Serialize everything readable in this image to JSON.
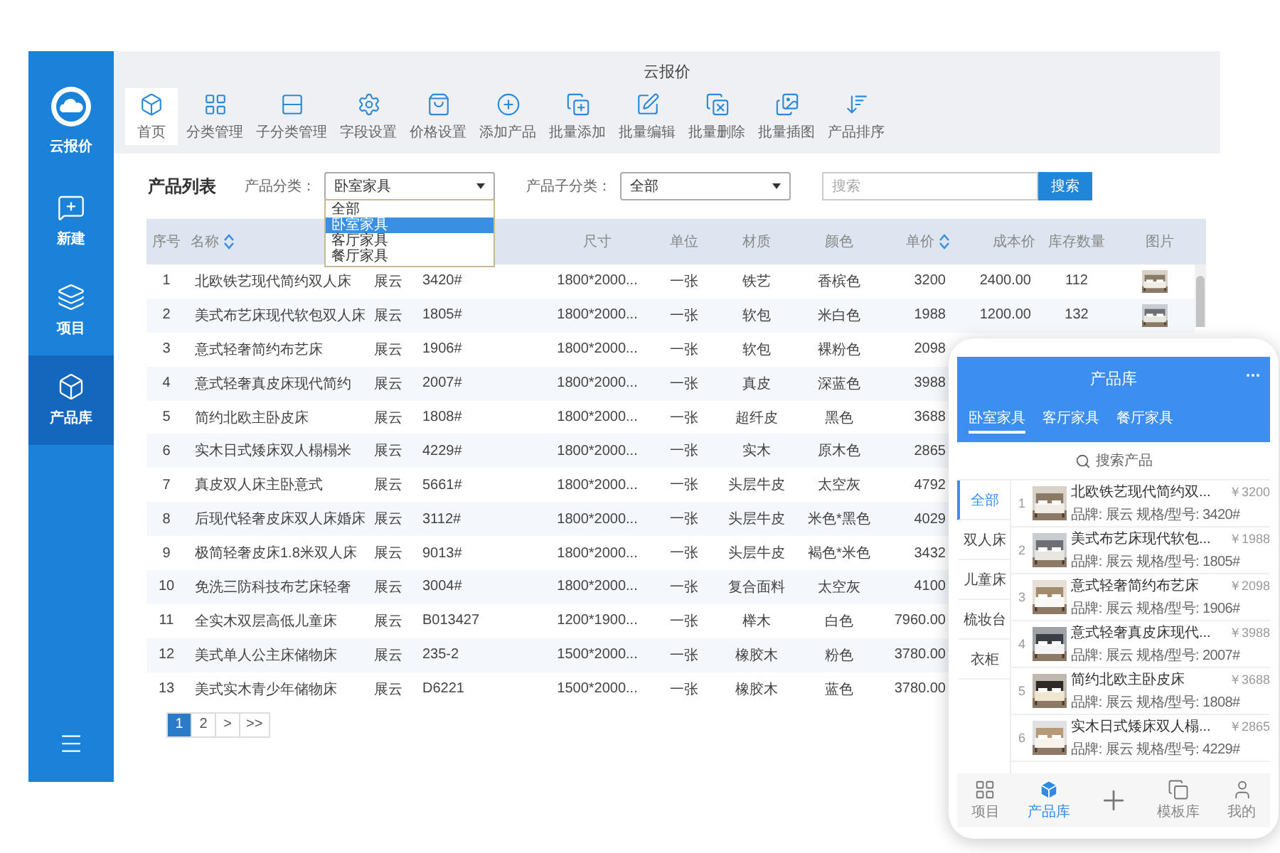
{
  "sidebar": {
    "brand": "云报价",
    "items": [
      {
        "label": "新建",
        "selected": false
      },
      {
        "label": "项目",
        "selected": false
      },
      {
        "label": "产品库",
        "selected": true
      }
    ]
  },
  "toolbar": {
    "title": "云报价",
    "items": [
      {
        "label": "首页",
        "selected": true
      },
      {
        "label": "分类管理",
        "selected": false
      },
      {
        "label": "子分类管理",
        "selected": false
      },
      {
        "label": "字段设置",
        "selected": false
      },
      {
        "label": "价格设置",
        "selected": false
      },
      {
        "label": "添加产品",
        "selected": false
      },
      {
        "label": "批量添加",
        "selected": false
      },
      {
        "label": "批量编辑",
        "selected": false
      },
      {
        "label": "批量删除",
        "selected": false
      },
      {
        "label": "批量插图",
        "selected": false
      },
      {
        "label": "产品排序",
        "selected": false
      }
    ]
  },
  "filters": {
    "heading": "产品列表",
    "category": {
      "label": "产品分类：",
      "value": "卧室家具",
      "expanded": true,
      "options": [
        {
          "label": "全部",
          "selected": false
        },
        {
          "label": "卧室家具",
          "selected": true
        },
        {
          "label": "客厅家具",
          "selected": false
        },
        {
          "label": "餐厅家具",
          "selected": false
        }
      ]
    },
    "subcategory": {
      "label": "产品子分类：",
      "value": "全部"
    },
    "search": {
      "placeholder": "搜索",
      "button": "搜索"
    }
  },
  "table": {
    "columns": [
      {
        "label": "序号",
        "sortable": false
      },
      {
        "label": "名称",
        "sortable": true
      },
      {},
      {},
      {
        "label": "尺寸",
        "sortable": false
      },
      {
        "label": "单位",
        "sortable": false
      },
      {
        "label": "材质",
        "sortable": false
      },
      {
        "label": "颜色",
        "sortable": false
      },
      {
        "label": "单价",
        "sortable": true
      },
      {
        "label": "成本价",
        "sortable": false
      },
      {
        "label": "库存数量",
        "sortable": false
      },
      {
        "label": "图片",
        "sortable": false
      }
    ],
    "rows": [
      {
        "cells": [
          "1",
          "北欧铁艺现代简约双人床",
          "展云",
          "3420#",
          "1800*2000...",
          "一张",
          "铁艺",
          "香槟色",
          "3200",
          "2400.00",
          "112"
        ],
        "photo": true
      },
      {
        "cells": [
          "2",
          "美式布艺床现代软包双人床",
          "展云",
          "1805#",
          "1800*2000...",
          "一张",
          "软包",
          "米白色",
          "1988",
          "1200.00",
          "132"
        ],
        "photo": true
      },
      {
        "cells": [
          "3",
          "意式轻奢简约布艺床",
          "展云",
          "1906#",
          "1800*2000...",
          "一张",
          "软包",
          "裸粉色",
          "2098"
        ]
      },
      {
        "cells": [
          "4",
          "意式轻奢真皮床现代简约",
          "展云",
          "2007#",
          "1800*2000...",
          "一张",
          "真皮",
          "深蓝色",
          "3988"
        ]
      },
      {
        "cells": [
          "5",
          "简约北欧主卧皮床",
          "展云",
          "1808#",
          "1800*2000...",
          "一张",
          "超纤皮",
          "黑色",
          "3688"
        ]
      },
      {
        "cells": [
          "6",
          "实木日式矮床双人榻榻米",
          "展云",
          "4229#",
          "1800*2000...",
          "一张",
          "实木",
          "原木色",
          "2865"
        ]
      },
      {
        "cells": [
          "7",
          "真皮双人床主卧意式",
          "展云",
          "5661#",
          "1800*2000...",
          "一张",
          "头层牛皮",
          "太空灰",
          "4792"
        ]
      },
      {
        "cells": [
          "8",
          "后现代轻奢皮床双人床婚床",
          "展云",
          "3112#",
          "1800*2000...",
          "一张",
          "头层牛皮",
          "米色*黑色",
          "4029"
        ]
      },
      {
        "cells": [
          "9",
          "极简轻奢皮床1.8米双人床",
          "展云",
          "9013#",
          "1800*2000...",
          "一张",
          "头层牛皮",
          "褐色*米色",
          "3432"
        ]
      },
      {
        "cells": [
          "10",
          "免洗三防科技布艺床轻奢",
          "展云",
          "3004#",
          "1800*2000...",
          "一张",
          "复合面料",
          "太空灰",
          "4100"
        ]
      },
      {
        "cells": [
          "11",
          "全实木双层高低儿童床",
          "展云",
          "B013427",
          "1200*1900...",
          "一张",
          "榉木",
          "白色",
          "7960.00"
        ]
      },
      {
        "cells": [
          "12",
          "美式单人公主床储物床",
          "展云",
          "235-2",
          "1500*2000...",
          "一张",
          "橡胶木",
          "粉色",
          "3780.00"
        ]
      },
      {
        "cells": [
          "13",
          "美式实木青少年储物床",
          "展云",
          "D6221",
          "1500*2000...",
          "一张",
          "橡胶木",
          "蓝色",
          "3780.00"
        ]
      }
    ]
  },
  "pagination": {
    "pages": [
      {
        "label": "1",
        "selected": true
      },
      {
        "label": "2",
        "selected": false
      }
    ],
    "buttons": [
      ">",
      ">>"
    ]
  },
  "phone": {
    "title": "产品库",
    "tabs": [
      {
        "label": "卧室家具",
        "selected": true
      },
      {
        "label": "客厅家具",
        "selected": false
      },
      {
        "label": "餐厅家具",
        "selected": false
      }
    ],
    "search": {
      "placeholder": "搜索产品"
    },
    "categories": [
      {
        "label": "全部",
        "selected": true
      },
      {
        "label": "双人床",
        "selected": false
      },
      {
        "label": "儿童床",
        "selected": false
      },
      {
        "label": "梳妆台",
        "selected": false
      },
      {
        "label": "衣柜",
        "selected": false
      }
    ],
    "products": [
      {
        "index": "1",
        "name": "北欧铁艺现代简约双...",
        "price": "￥3200",
        "spec": "品牌: 展云 规格/型号: 3420#"
      },
      {
        "index": "2",
        "name": "美式布艺床现代软包...",
        "price": "￥1988",
        "spec": "品牌: 展云 规格/型号: 1805#"
      },
      {
        "index": "3",
        "name": "意式轻奢简约布艺床",
        "price": "￥2098",
        "spec": "品牌: 展云 规格/型号: 1906#"
      },
      {
        "index": "4",
        "name": "意式轻奢真皮床现代...",
        "price": "￥3988",
        "spec": "品牌: 展云 规格/型号: 2007#"
      },
      {
        "index": "5",
        "name": "简约北欧主卧皮床",
        "price": "￥3688",
        "spec": "品牌: 展云 规格/型号: 1808#"
      },
      {
        "index": "6",
        "name": "实木日式矮床双人榻...",
        "price": "￥2865",
        "spec": "品牌: 展云 规格/型号: 4229#"
      }
    ],
    "nav": [
      {
        "kind": "tab",
        "label": "项目",
        "selected": false
      },
      {
        "kind": "tab",
        "label": "产品库",
        "selected": true
      },
      {
        "kind": "add",
        "selected": false
      },
      {
        "kind": "tab",
        "label": "模板库",
        "selected": false
      },
      {
        "kind": "tab",
        "label": "我的",
        "selected": false
      }
    ]
  }
}
